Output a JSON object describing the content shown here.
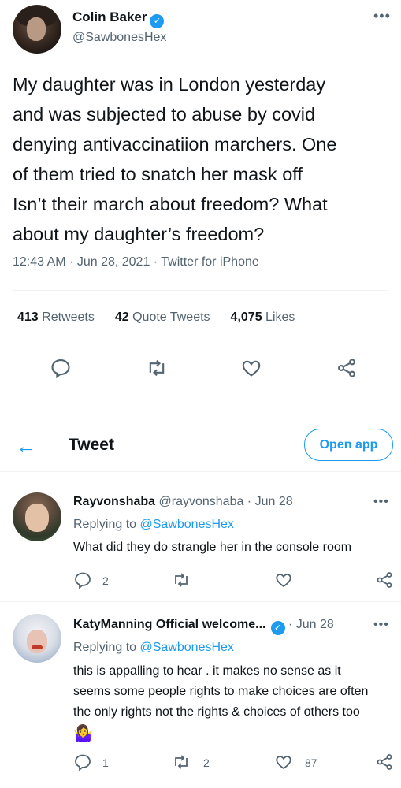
{
  "main_tweet": {
    "author_name": "Colin Baker",
    "author_handle": "@SawbonesHex",
    "more": "•••",
    "text_lines": [
      "My daughter was in London yesterday",
      "and was subjected to abuse by covid",
      "denying antivaccinatiion marchers. One",
      "of them tried to snatch her mask off",
      "Isn’t their march about freedom?  What",
      "about my daughter’s freedom?"
    ],
    "timestamp": "12:43 AM · Jun 28, 2021 · Twitter for iPhone",
    "stats": {
      "retweets_count": "413",
      "retweets_label": "Retweets",
      "quote_count": "42",
      "quote_label": "Quote Tweets",
      "likes_count": "4,075",
      "likes_label": "Likes"
    }
  },
  "nav": {
    "back_icon": "←",
    "title": "Tweet",
    "open_app": "Open app"
  },
  "replies": [
    {
      "name": "Rayvonshaba",
      "handle_date": "@rayvonshaba · Jun 28",
      "replying_prefix": "Replying to ",
      "replying_handle": "@SawbonesHex",
      "text": "What did they do strangle her in the console room",
      "reply_count": "2",
      "retweet_count": "",
      "like_count": "",
      "more": "•••"
    },
    {
      "name": "KatyManning Official welcome...",
      "handle_date": "· Jun 28",
      "replying_prefix": "Replying to ",
      "replying_handle": "@SawbonesHex",
      "text_lines": [
        "this is appalling to hear . it makes no sense as it",
        "seems some people rights to make choices are often",
        "the only rights not the rights & choices of others too"
      ],
      "emoji": "🤷‍♀️",
      "reply_count": "1",
      "retweet_count": "2",
      "like_count": "87",
      "more": "•••"
    }
  ],
  "colors": {
    "accent": "#1d9bf0",
    "text": "#0f1419",
    "secondary": "#536471",
    "divider": "#eff3f4"
  }
}
